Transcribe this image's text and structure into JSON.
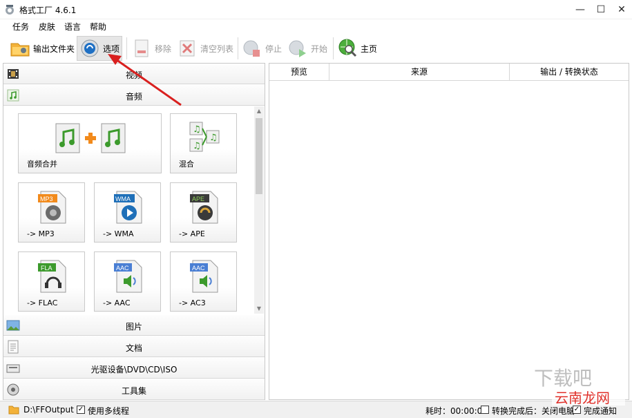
{
  "window": {
    "title": "格式工厂 4.6.1",
    "controls": [
      "—",
      "☐",
      "✕"
    ]
  },
  "menu": [
    "任务",
    "皮肤",
    "语言",
    "帮助"
  ],
  "toolbar": {
    "output_folder": "输出文件夹",
    "options": "选项",
    "remove": "移除",
    "clear_list": "清空列表",
    "stop": "停止",
    "start": "开始",
    "home": "主页"
  },
  "categories": {
    "video": "视频",
    "audio": "音频",
    "image": "图片",
    "document": "文档",
    "disc": "光驱设备\\DVD\\CD\\ISO",
    "tools": "工具集"
  },
  "tiles": {
    "merge": "音频合并",
    "mix": "混合",
    "mp3": "-> MP3",
    "wma": "-> WMA",
    "ape": "-> APE",
    "flac": "-> FLAC",
    "aac": "-> AAC",
    "ac3": "-> AC3"
  },
  "badges": {
    "mp3": "MP3",
    "wma": "WMA",
    "ape": "APE",
    "fla": "FLA",
    "aac": "AAC",
    "aac2": "AAC"
  },
  "table": {
    "columns": [
      "预览",
      "来源",
      "输出 / 转换状态"
    ]
  },
  "status": {
    "output_path": "D:\\FFOutput",
    "multithread": "使用多线程",
    "elapsed": "耗时：00:00:00",
    "after_convert": "转换完成后：关闭电脑",
    "notify": "完成通知"
  },
  "watermark": "云南龙网",
  "colors": {
    "accent_red": "#d9201f",
    "note_green": "#3c9a2c",
    "orange_plus": "#f28a1b"
  }
}
